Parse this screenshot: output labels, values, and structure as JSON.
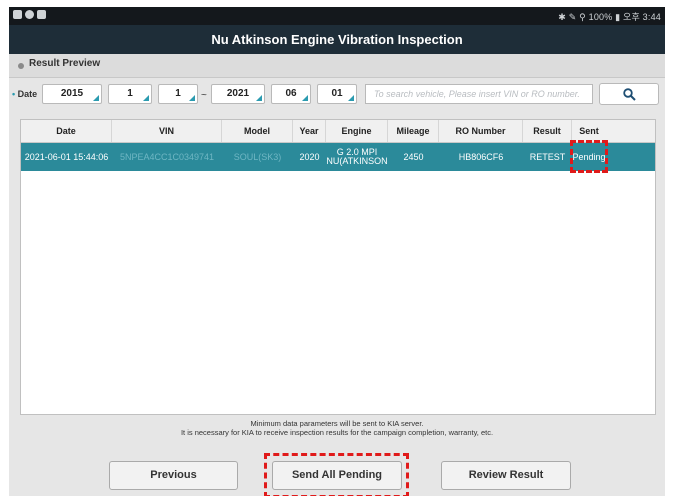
{
  "statusbar": {
    "left_icons": [
      "gallery-icon",
      "message-icon",
      "briefcase-icon"
    ],
    "right_text": "✱ ✎ ⚲ 100% ▮ 오후 3:44"
  },
  "header": {
    "title": "Nu Atkinson Engine Vibration Inspection"
  },
  "section": {
    "title": "Result Preview"
  },
  "filter": {
    "label": "Date",
    "from": {
      "year": "2015",
      "month": "1",
      "day": "1"
    },
    "separator": "~",
    "to": {
      "year": "2021",
      "month": "06",
      "day": "01"
    },
    "search_placeholder": "To search vehicle, Please insert VIN or RO number.",
    "search_icon": "search-icon"
  },
  "table": {
    "columns": [
      "Date",
      "VIN",
      "Model",
      "Year",
      "Engine",
      "Mileage",
      "RO Number",
      "Result",
      "Sent"
    ],
    "rows": [
      {
        "date": "2021-06-01 15:44:06",
        "vin": "5NPEA4CC1C0349741",
        "model": "SOUL(SK3)",
        "year": "2020",
        "engine": "G 2.0 MPI NU(ATKINSON",
        "mileage": "2450",
        "ro_number": "HB806CF6",
        "result": "RETEST",
        "sent": "Pending"
      }
    ]
  },
  "note": {
    "line1": "Minimum data parameters will be sent to KIA server.",
    "line2": "It is necessary for KIA to receive inspection results for the campaign completion, warranty, etc."
  },
  "buttons": {
    "previous": "Previous",
    "send_all": "Send All Pending",
    "review": "Review Result"
  },
  "colors": {
    "title_bar": "#1e2d38",
    "selected_row": "#2b8a9a",
    "accent": "#2b9bb0",
    "highlight": "#e01a1a"
  }
}
